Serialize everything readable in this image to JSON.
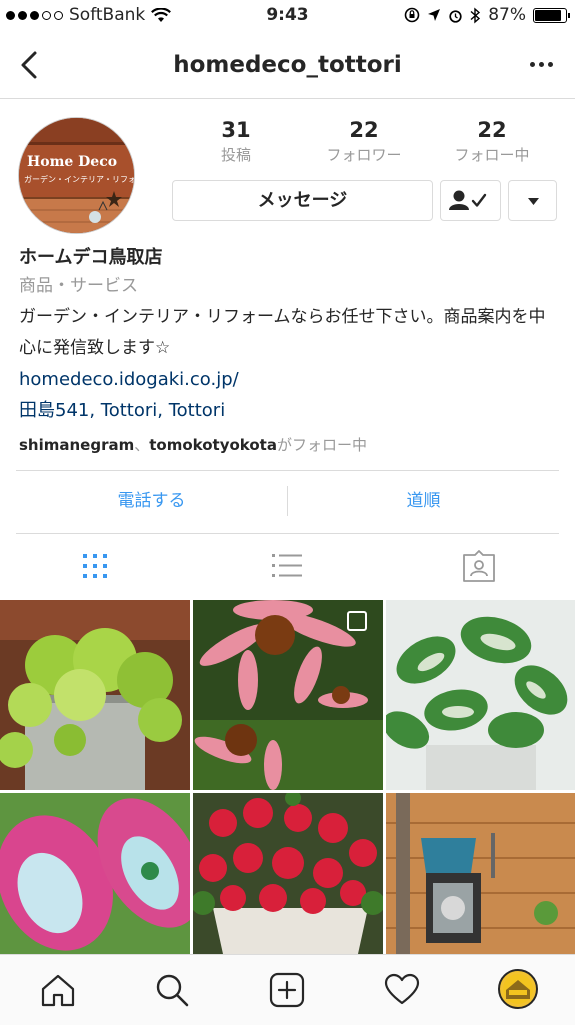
{
  "status": {
    "carrier": "SoftBank",
    "time": "9:43",
    "battery": "87%"
  },
  "navbar": {
    "title": "homedeco_tottori"
  },
  "profile": {
    "avatar_line1": "Home Deco",
    "avatar_line2": "ガーデン・インテリア・リフォーム",
    "stats": [
      {
        "num": "31",
        "label": "投稿"
      },
      {
        "num": "22",
        "label": "フォロワー"
      },
      {
        "num": "22",
        "label": "フォロー中"
      }
    ],
    "message_label": "メッセージ",
    "name": "ホームデコ鳥取店",
    "category": "商品・サービス",
    "description": "ガーデン・インテリア・リフォームならお任せ下さい。商品案内を中心に発信致します☆",
    "link": "homedeco.idogaki.co.jp/",
    "location": "田島541, Tottori, Tottori",
    "followed_by_1": "shimanegram",
    "followed_by_sep": "、",
    "followed_by_2": "tomokotyokota",
    "followed_by_suffix": "がフォロー中"
  },
  "actions": {
    "call": "電話する",
    "directions": "道順"
  },
  "colors": {
    "accent": "#3897f0",
    "link": "#003569",
    "muted": "#999999"
  }
}
